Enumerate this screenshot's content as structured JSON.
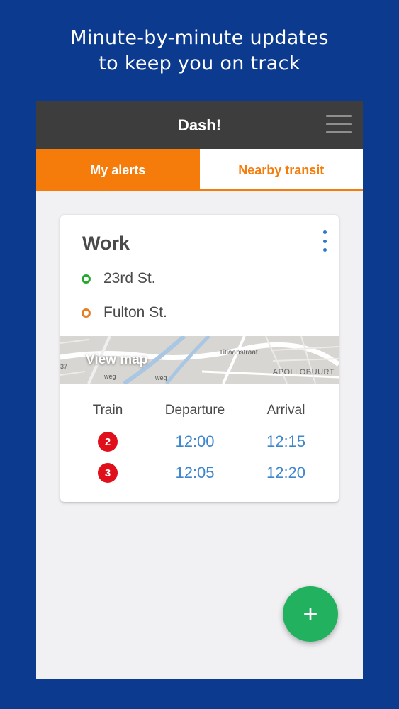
{
  "headline": {
    "line1": "Minute-by-minute updates",
    "line2": "to keep you on track"
  },
  "app": {
    "title": "Dash!",
    "menu_icon": "hamburger-menu-icon"
  },
  "tabs": [
    {
      "label": "My alerts",
      "active": true
    },
    {
      "label": "Nearby transit",
      "active": false
    }
  ],
  "alert_card": {
    "title": "Work",
    "overflow_icon": "more-vertical-icon",
    "origin": "23rd St.",
    "destination": "Fulton St.",
    "map": {
      "label": "View map",
      "street": "Titiaanstraat",
      "district": "APOLLOBUURT",
      "fragment_a": "37",
      "fragment_b": "weg",
      "fragment_c": "weg"
    },
    "schedule": {
      "headers": [
        "Train",
        "Departure",
        "Arrival"
      ],
      "rows": [
        {
          "train": "2",
          "departure": "12:00",
          "arrival": "12:15"
        },
        {
          "train": "3",
          "departure": "12:05",
          "arrival": "12:20"
        }
      ]
    }
  },
  "fab": {
    "label": "+",
    "icon": "plus-icon"
  },
  "colors": {
    "background": "#0b3a8f",
    "accent_orange": "#f57c0a",
    "appbar": "#3d3d3d",
    "link_blue": "#3e86cc",
    "train_badge_red": "#e0101b",
    "fab_green": "#22b15f",
    "origin_green": "#22a82e",
    "destination_orange": "#e67e22"
  }
}
